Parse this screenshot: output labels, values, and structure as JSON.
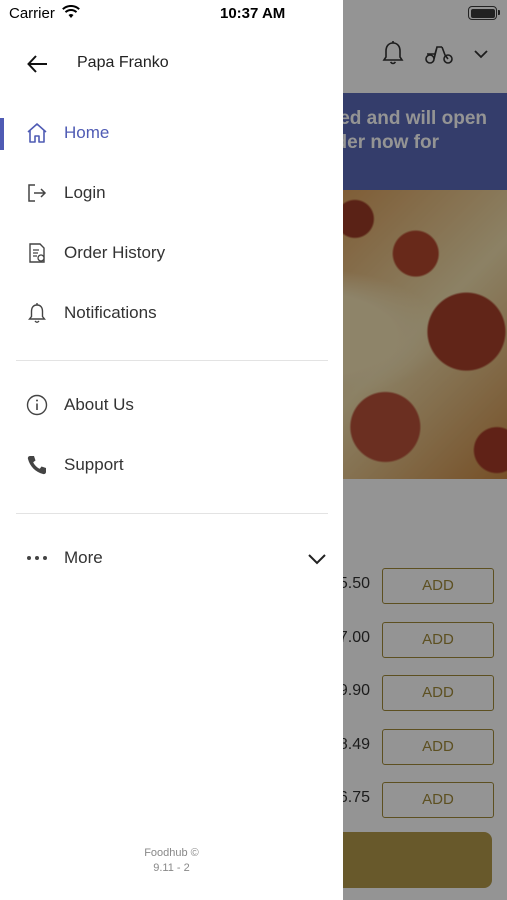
{
  "status_bar": {
    "carrier": "Carrier",
    "time": "10:37 AM"
  },
  "drawer": {
    "restaurant_name": "Papa Franko",
    "menu": [
      {
        "label": "Home",
        "icon": "home-icon",
        "active": true
      },
      {
        "label": "Login",
        "icon": "login-icon",
        "active": false
      },
      {
        "label": "Order History",
        "icon": "order-history-icon",
        "active": false
      },
      {
        "label": "Notifications",
        "icon": "bell-icon",
        "active": false
      }
    ],
    "secondary_menu": [
      {
        "label": "About Us",
        "icon": "info-icon"
      },
      {
        "label": "Support",
        "icon": "phone-icon"
      }
    ],
    "more_label": "More",
    "footer": {
      "brand": "Foodhub ©",
      "version": "9.11 - 2"
    }
  },
  "background": {
    "banner_line1": "ed and will open",
    "banner_line2": "rder now for",
    "prices": [
      "5.50",
      "7.00",
      "9.90",
      "8.49",
      "6.75"
    ],
    "add_label": "ADD"
  },
  "colors": {
    "accent": "#4f5bb4",
    "banner": "#5a6ab8",
    "add_button": "#a08a3a"
  }
}
